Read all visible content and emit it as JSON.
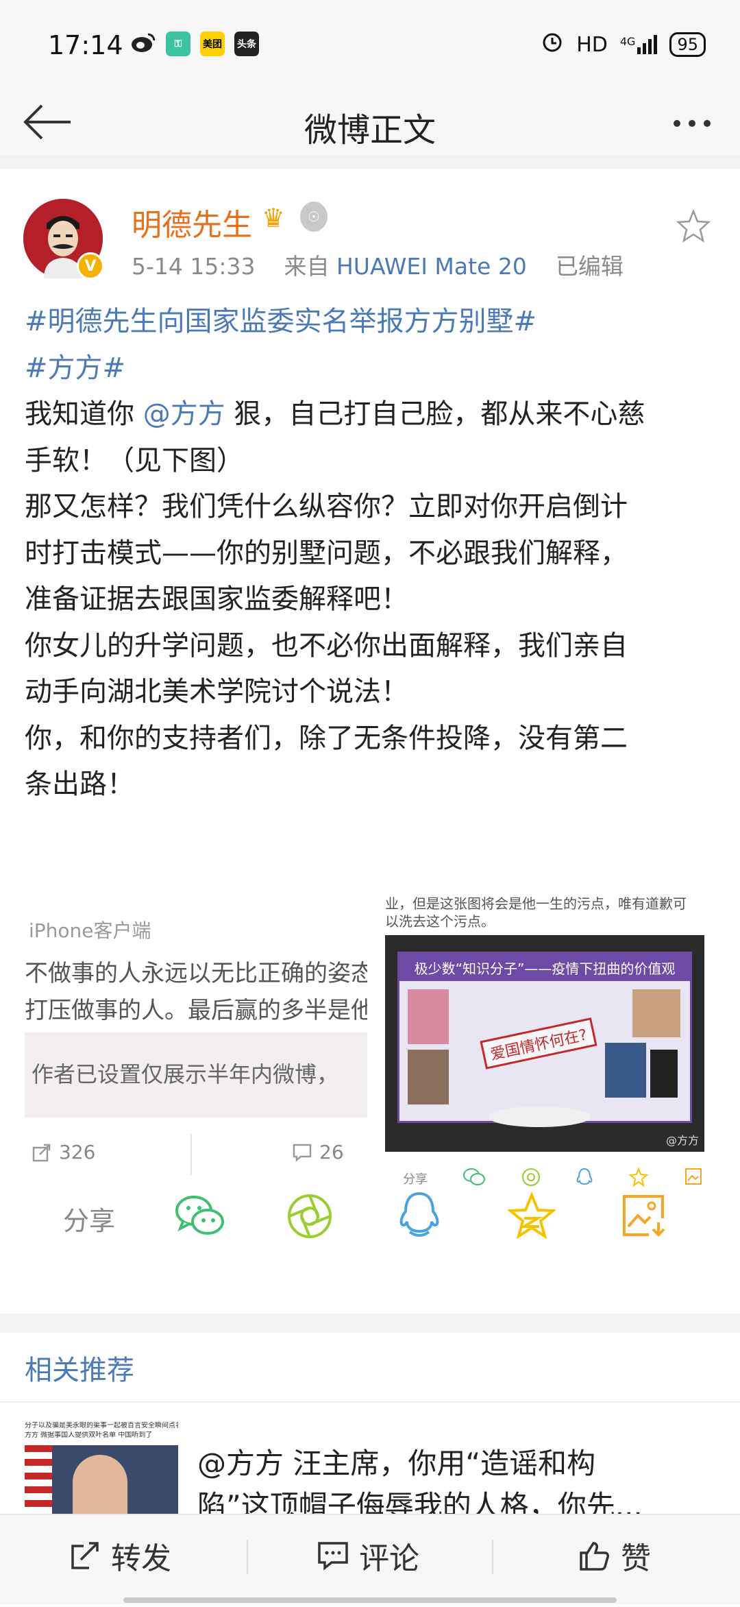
{
  "status_bar": {
    "time": "17:14",
    "app_icons": [
      "weibo-icon",
      "key-app-icon",
      "meituan-icon",
      "toutiao-icon"
    ],
    "meituan_label": "美团",
    "toutiao_label": "头条",
    "hd": "HD",
    "network": "4G",
    "battery": "95"
  },
  "nav": {
    "title": "微博正文"
  },
  "post": {
    "username": "明德先生",
    "timestamp": "5-14 15:33",
    "from_label": "来自",
    "device": "HUAWEI Mate 20",
    "edited": "已编辑",
    "lines": [
      "#明德先生向国家监委实名举报方方别墅#",
      "#方方#",
      "我知道你 @方方 狠，自己打自己脸，都从来不心慈",
      "手软！（见下图）",
      "那又怎样？我们凭什么纵容你？立即对你开启倒计",
      "时打击模式——你的别墅问题，不必跟我们解释，",
      "准备证据去跟国家监委解释吧！",
      "你女儿的升学问题，也不必你出面解释，我们亲自",
      "动手向湖北美术学院讨个说法！",
      "你，和你的支持者们，除了无条件投降，没有第二",
      "条出路！"
    ],
    "line3_before": "我知道你 ",
    "line3_mention": "@方方",
    "line3_after": " 狠，自己打自己脸，都从来不心慈"
  },
  "image_left": {
    "client": "iPhone客户端",
    "line1": "不做事的人永远以无比正确的姿态",
    "line2": "打压做事的人。最后赢的多半是他",
    "restricted": "作者已设置仅展示半年内微博，",
    "repost_count": "326",
    "comment_count": "26"
  },
  "image_right": {
    "cap1": "业，但是这张图将会是他一生的污点，唯有道歉可",
    "cap2": "以洗去这个污点。",
    "panel_title": "极少数“知识分子”——疫情下扭曲的价值观",
    "stamp": "爱国情怀何在?",
    "watermark": "@方方",
    "share_label": "分享"
  },
  "share": {
    "label": "分享",
    "icons": [
      "wechat-icon",
      "moments-icon",
      "qq-icon",
      "qzone-icon",
      "save-image-icon"
    ]
  },
  "related": {
    "title": "相关推荐",
    "thumb_caption1": "分子以及骗是美永眼的渠事一起被百言安全瞬间点名",
    "thumb_caption2": "方方 微据事国人提供双叶名单 中国听到了",
    "text_mention": "@方方",
    "text_line1_rest": " 汪主席，你用“造谣和构",
    "text_line2": "陷”这顶帽子侮辱我的人格，你先..."
  },
  "bottom_bar": {
    "repost": "转发",
    "comment": "评论",
    "like": "赞"
  },
  "colors": {
    "link_blue": "#4a7ab8",
    "username_orange": "#e86f1b",
    "wechat_green": "#3fbf74",
    "moments_green": "#9acd32",
    "qq_blue": "#4aa3df",
    "qzone_yellow": "#f5c400",
    "save_orange": "#f5a623"
  }
}
